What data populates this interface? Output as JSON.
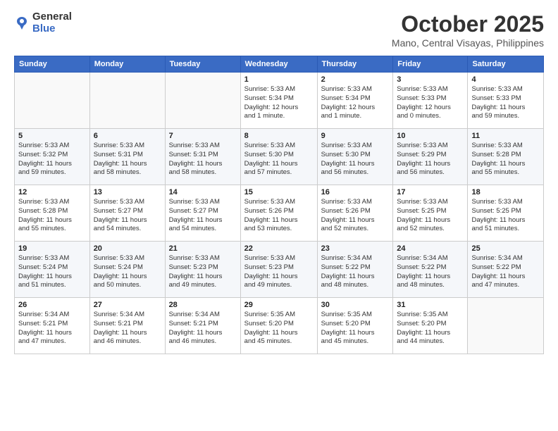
{
  "logo": {
    "general": "General",
    "blue": "Blue"
  },
  "title": "October 2025",
  "location": "Mano, Central Visayas, Philippines",
  "days_of_week": [
    "Sunday",
    "Monday",
    "Tuesday",
    "Wednesday",
    "Thursday",
    "Friday",
    "Saturday"
  ],
  "weeks": [
    [
      {
        "day": "",
        "info": ""
      },
      {
        "day": "",
        "info": ""
      },
      {
        "day": "",
        "info": ""
      },
      {
        "day": "1",
        "info": "Sunrise: 5:33 AM\nSunset: 5:34 PM\nDaylight: 12 hours\nand 1 minute."
      },
      {
        "day": "2",
        "info": "Sunrise: 5:33 AM\nSunset: 5:34 PM\nDaylight: 12 hours\nand 1 minute."
      },
      {
        "day": "3",
        "info": "Sunrise: 5:33 AM\nSunset: 5:33 PM\nDaylight: 12 hours\nand 0 minutes."
      },
      {
        "day": "4",
        "info": "Sunrise: 5:33 AM\nSunset: 5:33 PM\nDaylight: 11 hours\nand 59 minutes."
      }
    ],
    [
      {
        "day": "5",
        "info": "Sunrise: 5:33 AM\nSunset: 5:32 PM\nDaylight: 11 hours\nand 59 minutes."
      },
      {
        "day": "6",
        "info": "Sunrise: 5:33 AM\nSunset: 5:31 PM\nDaylight: 11 hours\nand 58 minutes."
      },
      {
        "day": "7",
        "info": "Sunrise: 5:33 AM\nSunset: 5:31 PM\nDaylight: 11 hours\nand 58 minutes."
      },
      {
        "day": "8",
        "info": "Sunrise: 5:33 AM\nSunset: 5:30 PM\nDaylight: 11 hours\nand 57 minutes."
      },
      {
        "day": "9",
        "info": "Sunrise: 5:33 AM\nSunset: 5:30 PM\nDaylight: 11 hours\nand 56 minutes."
      },
      {
        "day": "10",
        "info": "Sunrise: 5:33 AM\nSunset: 5:29 PM\nDaylight: 11 hours\nand 56 minutes."
      },
      {
        "day": "11",
        "info": "Sunrise: 5:33 AM\nSunset: 5:28 PM\nDaylight: 11 hours\nand 55 minutes."
      }
    ],
    [
      {
        "day": "12",
        "info": "Sunrise: 5:33 AM\nSunset: 5:28 PM\nDaylight: 11 hours\nand 55 minutes."
      },
      {
        "day": "13",
        "info": "Sunrise: 5:33 AM\nSunset: 5:27 PM\nDaylight: 11 hours\nand 54 minutes."
      },
      {
        "day": "14",
        "info": "Sunrise: 5:33 AM\nSunset: 5:27 PM\nDaylight: 11 hours\nand 54 minutes."
      },
      {
        "day": "15",
        "info": "Sunrise: 5:33 AM\nSunset: 5:26 PM\nDaylight: 11 hours\nand 53 minutes."
      },
      {
        "day": "16",
        "info": "Sunrise: 5:33 AM\nSunset: 5:26 PM\nDaylight: 11 hours\nand 52 minutes."
      },
      {
        "day": "17",
        "info": "Sunrise: 5:33 AM\nSunset: 5:25 PM\nDaylight: 11 hours\nand 52 minutes."
      },
      {
        "day": "18",
        "info": "Sunrise: 5:33 AM\nSunset: 5:25 PM\nDaylight: 11 hours\nand 51 minutes."
      }
    ],
    [
      {
        "day": "19",
        "info": "Sunrise: 5:33 AM\nSunset: 5:24 PM\nDaylight: 11 hours\nand 51 minutes."
      },
      {
        "day": "20",
        "info": "Sunrise: 5:33 AM\nSunset: 5:24 PM\nDaylight: 11 hours\nand 50 minutes."
      },
      {
        "day": "21",
        "info": "Sunrise: 5:33 AM\nSunset: 5:23 PM\nDaylight: 11 hours\nand 49 minutes."
      },
      {
        "day": "22",
        "info": "Sunrise: 5:33 AM\nSunset: 5:23 PM\nDaylight: 11 hours\nand 49 minutes."
      },
      {
        "day": "23",
        "info": "Sunrise: 5:34 AM\nSunset: 5:22 PM\nDaylight: 11 hours\nand 48 minutes."
      },
      {
        "day": "24",
        "info": "Sunrise: 5:34 AM\nSunset: 5:22 PM\nDaylight: 11 hours\nand 48 minutes."
      },
      {
        "day": "25",
        "info": "Sunrise: 5:34 AM\nSunset: 5:22 PM\nDaylight: 11 hours\nand 47 minutes."
      }
    ],
    [
      {
        "day": "26",
        "info": "Sunrise: 5:34 AM\nSunset: 5:21 PM\nDaylight: 11 hours\nand 47 minutes."
      },
      {
        "day": "27",
        "info": "Sunrise: 5:34 AM\nSunset: 5:21 PM\nDaylight: 11 hours\nand 46 minutes."
      },
      {
        "day": "28",
        "info": "Sunrise: 5:34 AM\nSunset: 5:21 PM\nDaylight: 11 hours\nand 46 minutes."
      },
      {
        "day": "29",
        "info": "Sunrise: 5:35 AM\nSunset: 5:20 PM\nDaylight: 11 hours\nand 45 minutes."
      },
      {
        "day": "30",
        "info": "Sunrise: 5:35 AM\nSunset: 5:20 PM\nDaylight: 11 hours\nand 45 minutes."
      },
      {
        "day": "31",
        "info": "Sunrise: 5:35 AM\nSunset: 5:20 PM\nDaylight: 11 hours\nand 44 minutes."
      },
      {
        "day": "",
        "info": ""
      }
    ]
  ]
}
